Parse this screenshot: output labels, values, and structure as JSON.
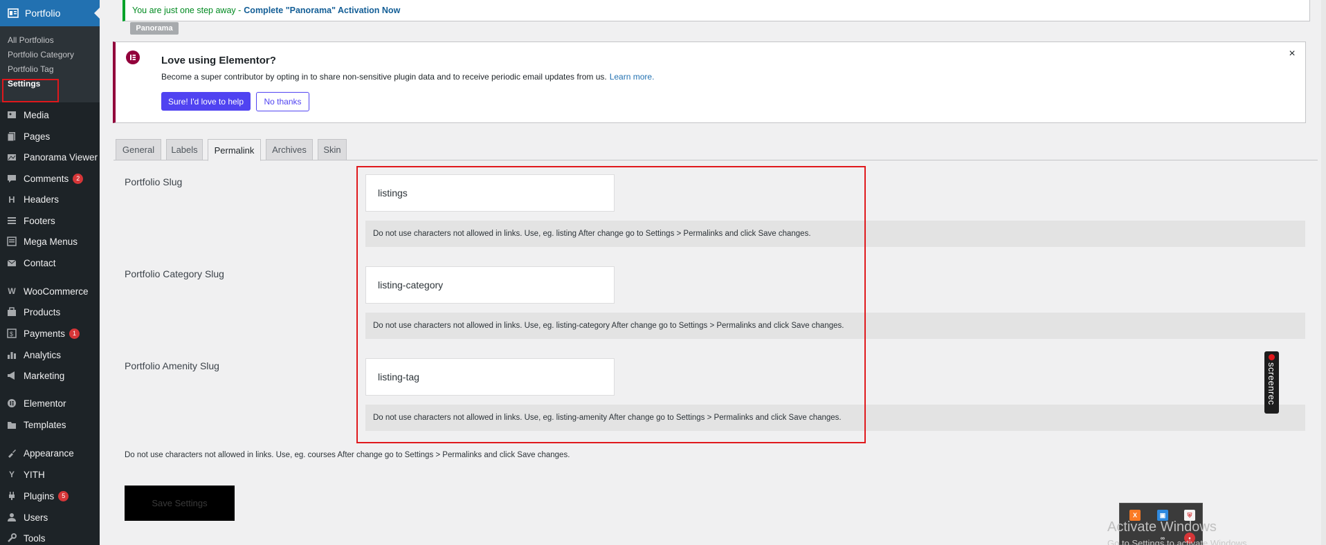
{
  "sidebar": {
    "active_item": "Portfolio",
    "submenu": [
      "All Portfolios",
      "Portfolio Category",
      "Portfolio Tag",
      "Settings"
    ],
    "items": [
      {
        "label": "Media",
        "icon": "media-icon"
      },
      {
        "label": "Pages",
        "icon": "pages-icon"
      },
      {
        "label": "Panorama Viewer",
        "icon": "panorama-icon"
      },
      {
        "label": "Comments",
        "icon": "comments-icon",
        "count": "2"
      },
      {
        "label": "Headers",
        "icon": "header-icon"
      },
      {
        "label": "Footers",
        "icon": "footer-icon"
      },
      {
        "label": "Mega Menus",
        "icon": "mega-menu-icon"
      },
      {
        "label": "Contact",
        "icon": "mail-icon"
      },
      {
        "label": "WooCommerce",
        "icon": "woocommerce-icon"
      },
      {
        "label": "Products",
        "icon": "products-icon"
      },
      {
        "label": "Payments",
        "icon": "payments-icon",
        "count": "1"
      },
      {
        "label": "Analytics",
        "icon": "analytics-icon"
      },
      {
        "label": "Marketing",
        "icon": "marketing-icon"
      },
      {
        "label": "Elementor",
        "icon": "elementor-icon"
      },
      {
        "label": "Templates",
        "icon": "templates-icon"
      },
      {
        "label": "Appearance",
        "icon": "appearance-icon"
      },
      {
        "label": "YITH",
        "icon": "yith-icon"
      },
      {
        "label": "Plugins",
        "icon": "plugins-icon",
        "count": "5"
      },
      {
        "label": "Users",
        "icon": "users-icon"
      },
      {
        "label": "Tools",
        "icon": "tools-icon"
      }
    ]
  },
  "notice": {
    "message": "You are just one step away -",
    "link": "Complete \"Panorama\" Activation Now",
    "badge": "Panorama"
  },
  "elementor_notice": {
    "title": "Love using Elementor?",
    "text": "Become a super contributor by opting in to share non-sensitive plugin data and to receive periodic email updates from us.",
    "learn_more": "Learn more.",
    "primary_button": "Sure! I'd love to help",
    "secondary_button": "No thanks",
    "close": "×"
  },
  "tabs": [
    "General",
    "Labels",
    "Permalink",
    "Archives",
    "Skin"
  ],
  "active_tab": "Permalink",
  "fields": [
    {
      "label": "Portfolio Slug",
      "value": "listings",
      "desc": "Do not use characters not allowed in links. Use, eg. listing After change go to Settings > Permalinks and click Save changes."
    },
    {
      "label": "Portfolio Category Slug",
      "value": "listing-category",
      "desc": "Do not use characters not allowed in links. Use, eg. listing-category After change go to Settings > Permalinks and click Save changes."
    },
    {
      "label": "Portfolio Amenity Slug",
      "value": "listing-tag",
      "desc": "Do not use characters not allowed in links. Use, eg. listing-amenity After change go to Settings > Permalinks and click Save changes."
    }
  ],
  "bottom_desc": "Do not use characters not allowed in links. Use, eg. courses After change go to Settings > Permalinks and click Save changes.",
  "save_button": "Save Settings",
  "overlay": {
    "screenrec": "screenrec",
    "activate_title": "Activate Windows",
    "activate_sub": "Go to Settings to activate Windows."
  },
  "colors": {
    "sidebar_bg": "#1d2327",
    "active_menu": "#2271b1",
    "highlight_border": "#e0181c",
    "elementor_button": "#5043f1"
  }
}
